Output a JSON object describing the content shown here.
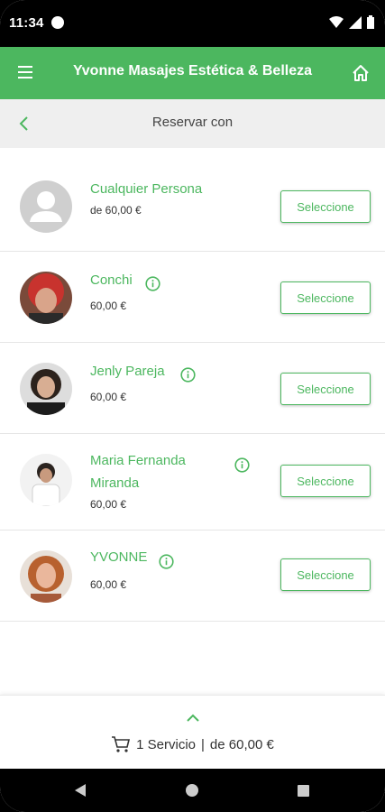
{
  "status": {
    "time": "11:34"
  },
  "app_bar": {
    "title": "Yvonne Masajes Estética & Belleza"
  },
  "subbar": {
    "title": "Reservar con"
  },
  "staff": [
    {
      "name_lines": [
        "Cualquier Persona"
      ],
      "price": "de 60,00 €",
      "button": "Seleccione",
      "info": false,
      "avatar": "generic"
    },
    {
      "name_lines": [
        "Conchi"
      ],
      "price": "60,00 €",
      "button": "Seleccione",
      "info": true,
      "avatar": "photo-red-hair"
    },
    {
      "name_lines": [
        "Jenly Pareja"
      ],
      "price": "60,00 €",
      "button": "Seleccione",
      "info": true,
      "avatar": "photo-dark-hair"
    },
    {
      "name_lines": [
        "Maria Fernanda",
        "Miranda"
      ],
      "price": "60,00 €",
      "button": "Seleccione",
      "info": true,
      "avatar": "photo-white-coat"
    },
    {
      "name_lines": [
        "YVONNE"
      ],
      "price": "60,00 €",
      "button": "Seleccione",
      "info": true,
      "avatar": "photo-auburn-hair"
    }
  ],
  "cart": {
    "count_label": "1 Servicio",
    "separator": "|",
    "total": "de 60,00 €"
  },
  "colors": {
    "primary": "#4cb75f",
    "subbar": "#efefef",
    "status_bar": "#000000"
  }
}
